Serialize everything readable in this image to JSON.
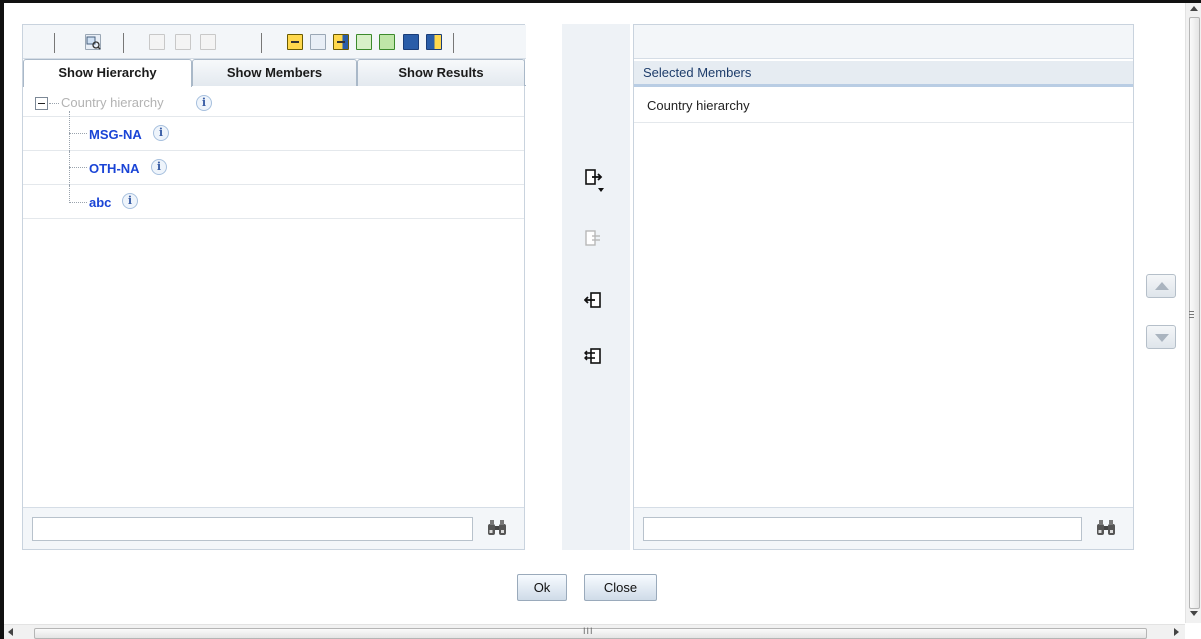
{
  "left_panel": {
    "tabs": [
      {
        "label": "Show Hierarchy",
        "active": true
      },
      {
        "label": "Show Members",
        "active": false
      },
      {
        "label": "Show Results",
        "active": false
      }
    ],
    "toolbar_icons": [
      {
        "name": "view-icon",
        "enabled": true
      },
      {
        "name": "add-child-icon",
        "enabled": false
      },
      {
        "name": "edit-node-icon",
        "enabled": false
      },
      {
        "name": "delete-node-icon",
        "enabled": false
      },
      {
        "name": "collapse-all-icon",
        "enabled": true
      },
      {
        "name": "expand-all-icon",
        "enabled": true
      },
      {
        "name": "show-code-icon",
        "enabled": true
      },
      {
        "name": "hierarchy-icon",
        "enabled": true
      },
      {
        "name": "hierarchy-alt-icon",
        "enabled": true
      },
      {
        "name": "list-view-icon",
        "enabled": true
      },
      {
        "name": "properties-icon",
        "enabled": true
      }
    ],
    "tree": {
      "root_label": "Country hierarchy",
      "children": [
        "MSG-NA",
        "OTH-NA",
        "abc"
      ]
    },
    "search": {
      "value": "",
      "placeholder": ""
    }
  },
  "middle_actions": [
    {
      "name": "select-button",
      "enabled": true
    },
    {
      "name": "select-all-button",
      "enabled": false
    },
    {
      "name": "deselect-button",
      "enabled": true
    },
    {
      "name": "deselect-all-button",
      "enabled": true
    }
  ],
  "right_panel": {
    "header": "Selected Members",
    "items": [
      "Country hierarchy"
    ],
    "search": {
      "value": "",
      "placeholder": ""
    }
  },
  "buttons": {
    "ok": "Ok",
    "close": "Close"
  },
  "scrollbars": {
    "horizontal_grip": "III"
  },
  "colors": {
    "link_blue": "#1a44d6",
    "disabled_gray": "#b3b3b3",
    "header_bg": "#e6ecf2"
  }
}
